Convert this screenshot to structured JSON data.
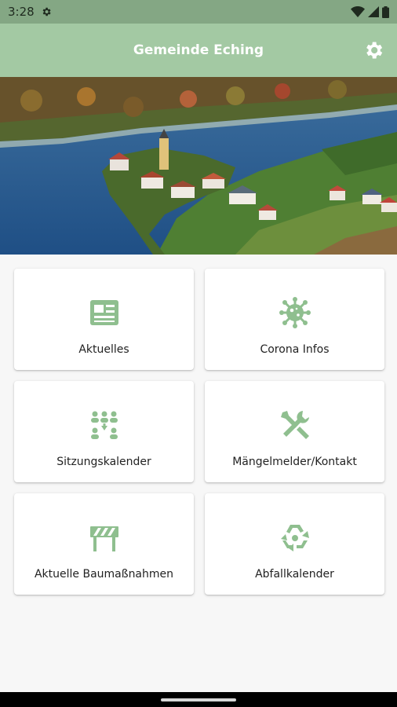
{
  "status_bar": {
    "time": "3:28"
  },
  "app_bar": {
    "title": "Gemeinde Eching"
  },
  "colors": {
    "accent": "#a3c9a3",
    "icon": "#8fbf8f",
    "status_bar": "#84a784"
  },
  "tiles": [
    {
      "label": "Aktuelles",
      "icon": "newspaper-icon"
    },
    {
      "label": "Corona Infos",
      "icon": "virus-icon"
    },
    {
      "label": "Sitzungskalender",
      "icon": "meeting-icon"
    },
    {
      "label": "Mängelmelder/Kontakt",
      "icon": "tools-icon"
    },
    {
      "label": "Aktuelle Baumaßnahmen",
      "icon": "roadblock-icon"
    },
    {
      "label": "Abfallkalender",
      "icon": "recycle-icon"
    }
  ]
}
